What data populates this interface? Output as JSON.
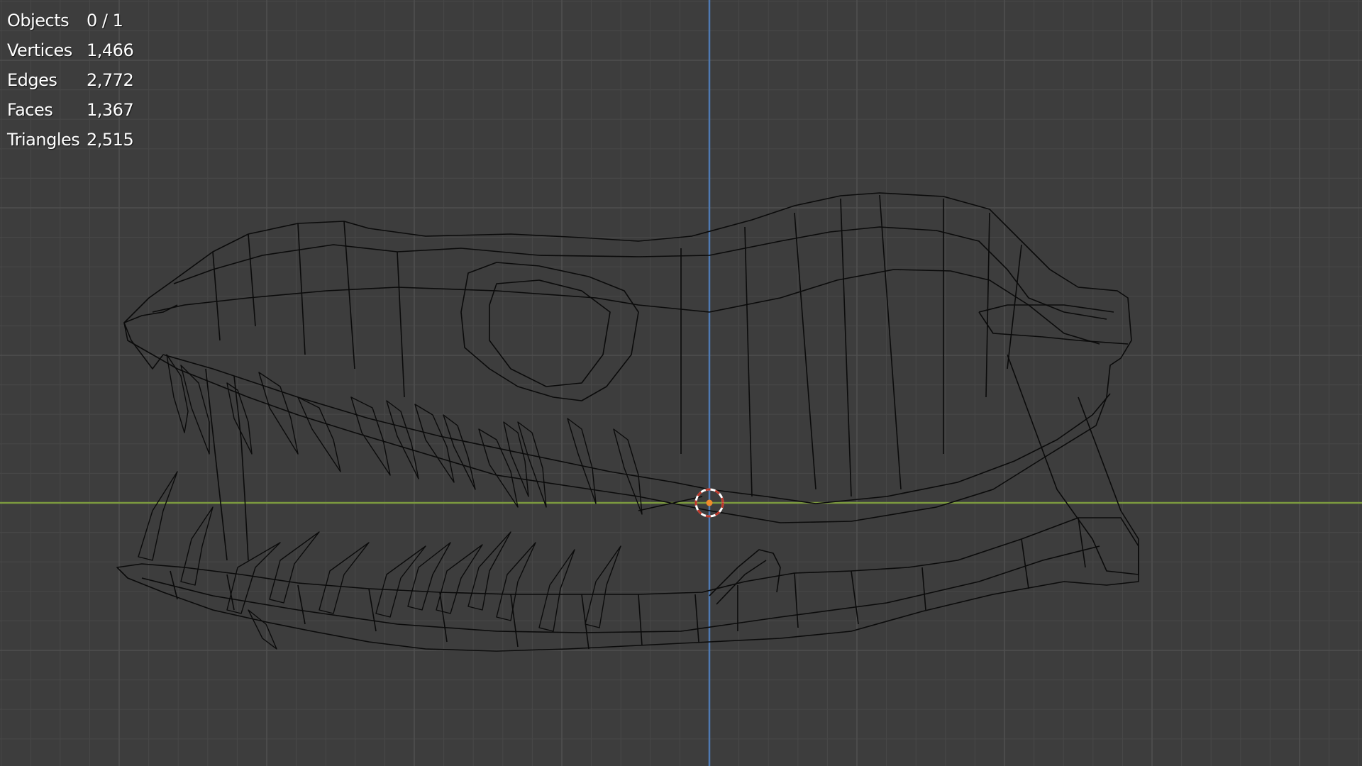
{
  "viewport": {
    "background": "#3d3d3d",
    "grid_minor_color": "#474747",
    "grid_major_color": "#4f4f4f",
    "x_axis_color": "#7c9a3f",
    "z_axis_color": "#4f7ab3",
    "wire_color": "#0b0b0b",
    "origin_icon": "3d-cursor-icon",
    "origin_dot_color": "#f08a2a",
    "cursor_ring_colors": [
      "#c0392b",
      "#ffffff"
    ]
  },
  "stats": [
    {
      "label": "Objects",
      "value": "0 / 1"
    },
    {
      "label": "Vertices",
      "value": "1,466"
    },
    {
      "label": "Edges",
      "value": "2,772"
    },
    {
      "label": "Faces",
      "value": "1,367"
    },
    {
      "label": "Triangles",
      "value": "2,515"
    }
  ]
}
